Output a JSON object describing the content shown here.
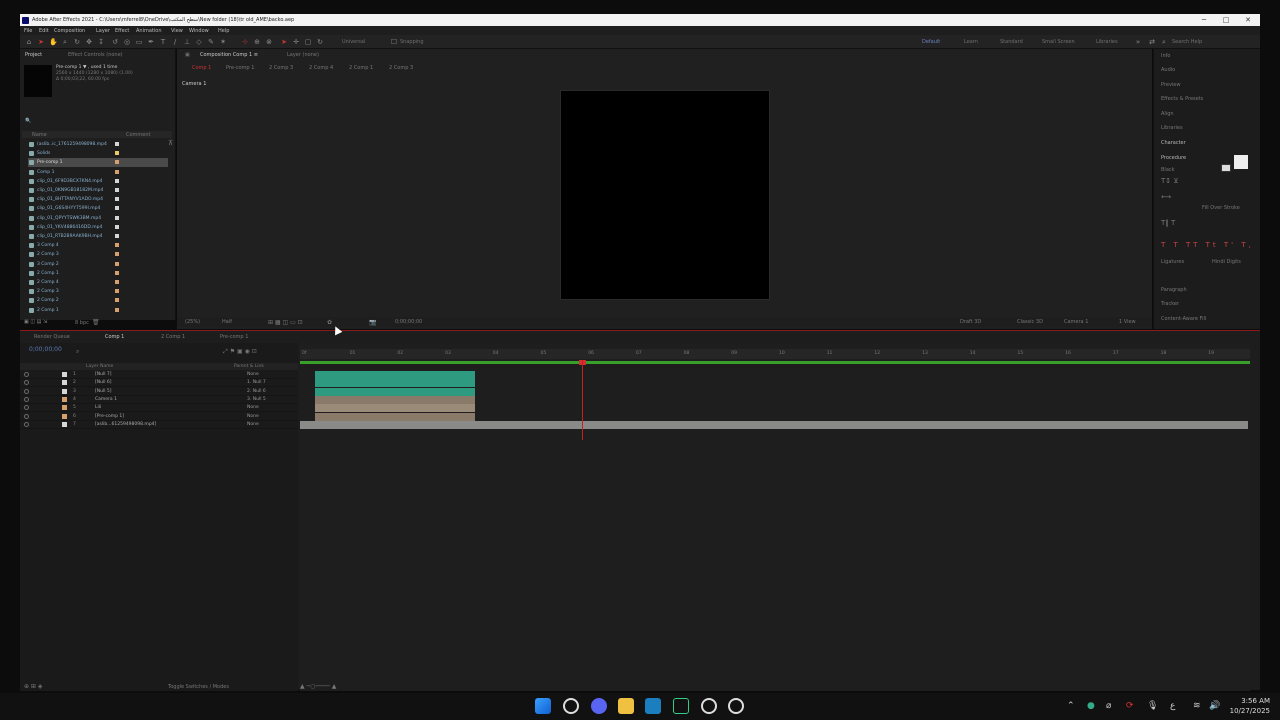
{
  "window": {
    "title": "Adobe After Effects 2021 - C:\\Users\\mferrel8\\OneDrive\\سطح المكتب\\New folder (18)\\tr old_AME\\backo.aep",
    "minimize": "─",
    "maximize": "□",
    "close": "✕"
  },
  "menu": [
    "File",
    "Edit",
    "Composition",
    "Layer",
    "Effect",
    "Animation",
    "View",
    "Window",
    "Help"
  ],
  "toolbar": {
    "universal_label": "Universal",
    "snapping_label": "Snapping",
    "workspaces": [
      "Default",
      "Learn",
      "Standard",
      "Small Screen",
      "Libraries"
    ],
    "active_workspace": "Default",
    "search_placeholder": "Search Help"
  },
  "project": {
    "tabs": [
      "Project",
      "Effect Controls (none)"
    ],
    "active_tab": "Project",
    "info_line1": "Pre-comp 1 ▼ , used 1 time",
    "info_line2": "2560 x 1440 (1280 x 1080) (1.00)",
    "info_line3": "Δ 0;00;03;22, 60.00 fps",
    "search_placeholder": "🔍",
    "col_name": "Name",
    "col_comment": "Comment",
    "items": [
      {
        "name": "(aslib..ic_1761259498098.mp4",
        "color": "#d6d6d6"
      },
      {
        "name": "Solids",
        "color": "#e8c96a"
      },
      {
        "name": "Pre-comp 1",
        "color": "#d5a06b",
        "selected": true
      },
      {
        "name": "Comp 1",
        "color": "#d5a06b"
      },
      {
        "name": "clip_01_6F9D3BCX7KN4.mp4",
        "color": "#d6d6d6"
      },
      {
        "name": "clip_01_0KN9GB18182M.mp4",
        "color": "#d6d6d6"
      },
      {
        "name": "clip_01_8HTTANYV1ADO.mp4",
        "color": "#d6d6d6"
      },
      {
        "name": "clip_01_G6S4HYY7599I.mp4",
        "color": "#d6d6d6"
      },
      {
        "name": "clip_01_QPYYTSWK3BM.mp4",
        "color": "#d6d6d6"
      },
      {
        "name": "clip_01_YKV4886416DD.mp4",
        "color": "#d6d6d6"
      },
      {
        "name": "clip_01_RTB2B9AAK9BH.mp4",
        "color": "#d6d6d6"
      },
      {
        "name": "3 Comp 4",
        "color": "#d5a06b"
      },
      {
        "name": "2 Comp 3",
        "color": "#d5a06b"
      },
      {
        "name": "3 Comp 2",
        "color": "#d5a06b"
      },
      {
        "name": "2 Comp 1",
        "color": "#d5a06b"
      },
      {
        "name": "2 Comp 4",
        "color": "#d5a06b"
      },
      {
        "name": "2 Comp 3",
        "color": "#d5a06b"
      },
      {
        "name": "2 Comp 2",
        "color": "#d5a06b"
      },
      {
        "name": "2 Comp 1",
        "color": "#d5a06b"
      }
    ],
    "footer_bpc": "8 bpc"
  },
  "composition": {
    "panel_tabs": [
      "Composition Comp 1 ≡",
      "Layer (none)"
    ],
    "breadcrumbs": [
      "Comp 1",
      "Pre-comp 1",
      "2 Comp 3",
      "2 Comp 4",
      "2 Comp 1",
      "2 Comp 3"
    ],
    "active_camera": "Camera 1",
    "zoom": "(25%)",
    "resolution": "Half",
    "timecode": "0;00;00;00",
    "draft_label": "Draft 3D",
    "renderer": "Classic 3D",
    "camera": "Camera 1",
    "view": "1 View"
  },
  "right_panel": {
    "items": [
      "Info",
      "Audio",
      "Preview",
      "Effects & Presets",
      "Align",
      "Libraries",
      "Character"
    ],
    "font": "Procedure",
    "style": "Black",
    "stroke": "Fill Over Stroke",
    "ligatures": "Ligatures",
    "hindi_digits": "Hindi Digits",
    "lower_items": [
      "Paragraph",
      "Tracker",
      "Content-Aware Fill"
    ]
  },
  "timeline": {
    "tabs": [
      "Render Queue",
      "Comp 1",
      "2 Comp 1",
      "Pre-comp 1"
    ],
    "active_tab": "Comp 1",
    "timecode": "0;00;00;00",
    "col_layer_name": "Layer Name",
    "col_parent": "Parent & Link",
    "ticks": [
      "0f",
      "01",
      "02",
      "03",
      "04",
      "05",
      "06",
      "07",
      "08",
      "09",
      "10",
      "11",
      "12",
      "13",
      "14",
      "15",
      "16",
      "17",
      "18",
      "19"
    ],
    "layers": [
      {
        "num": "1",
        "name": "[Null 7]",
        "parent": "None",
        "color": "#d6d6d6"
      },
      {
        "num": "2",
        "name": "[Null 6]",
        "parent": "1. Null 7",
        "color": "#d6d6d6"
      },
      {
        "num": "3",
        "name": "[Null 5]",
        "parent": "2. Null 6",
        "color": "#d6d6d6"
      },
      {
        "num": "4",
        "name": "Camera 1",
        "parent": "3. Null 5",
        "color": "#d5a06b"
      },
      {
        "num": "5",
        "name": "Lili",
        "parent": "None",
        "color": "#d5a06b"
      },
      {
        "num": "6",
        "name": "[Pre-comp 1]",
        "parent": "None",
        "color": "#d5a06b"
      },
      {
        "num": "7",
        "name": "[aslib...61259498098.mp4]",
        "parent": "None",
        "color": "#d6d6d6"
      }
    ],
    "toggle_label": "Toggle Switches / Modes"
  },
  "taskbar": {
    "time": "3:56 AM",
    "date": "10/27/2025"
  }
}
